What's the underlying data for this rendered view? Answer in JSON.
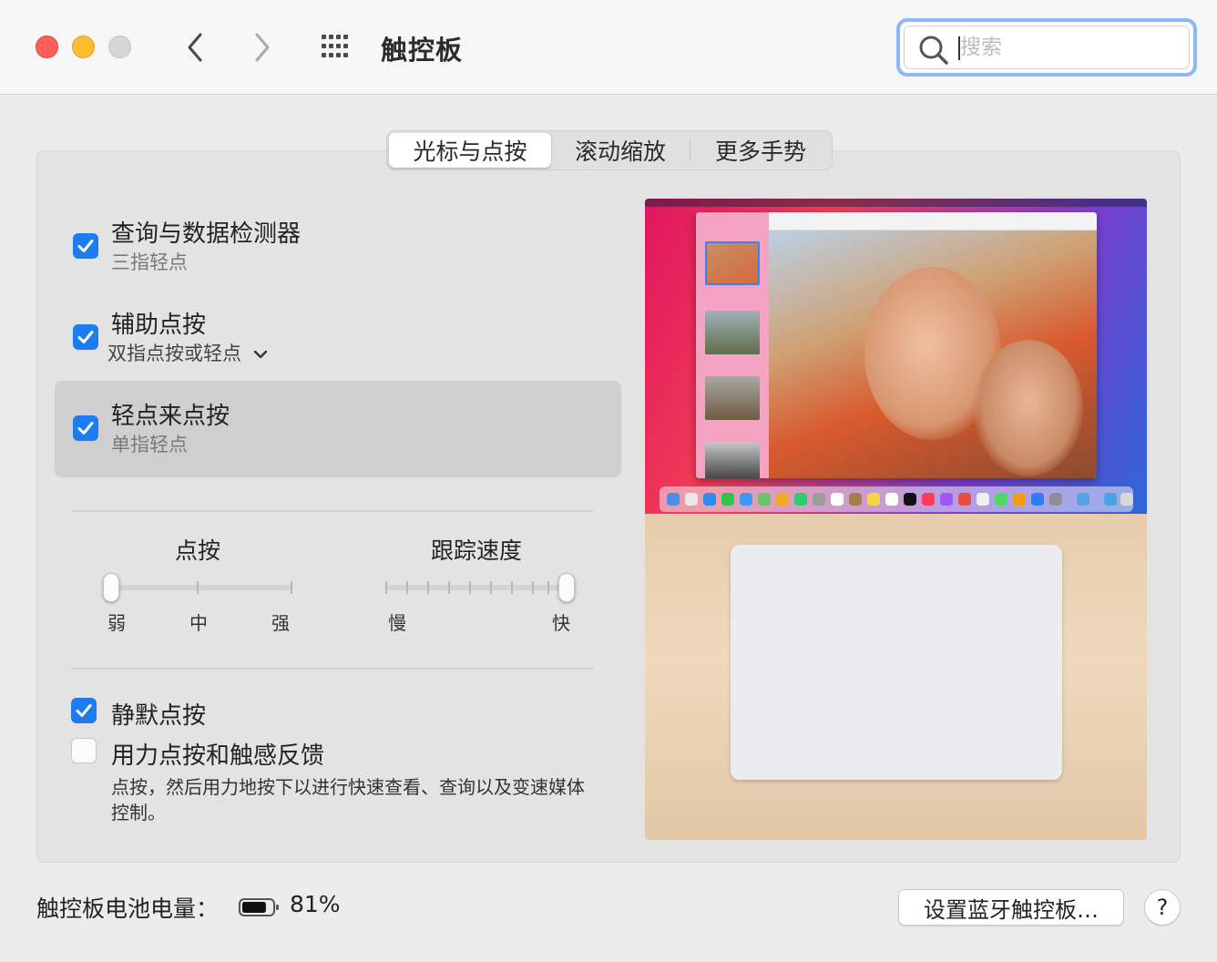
{
  "window": {
    "title": "触控板",
    "search_placeholder": "搜索"
  },
  "tabs": [
    {
      "label": "光标与点按",
      "active": true
    },
    {
      "label": "滚动缩放",
      "active": false
    },
    {
      "label": "更多手势",
      "active": false
    }
  ],
  "options": {
    "lookup": {
      "title": "查询与数据检测器",
      "subtitle": "三指轻点",
      "checked": true
    },
    "secondary_click": {
      "title": "辅助点按",
      "subtitle": "双指点按或轻点",
      "checked": true
    },
    "tap_to_click": {
      "title": "轻点来点按",
      "subtitle": "单指轻点",
      "checked": true
    },
    "silent_click": {
      "title": "静默点按",
      "checked": true
    },
    "force_click": {
      "title": "用力点按和触感反馈",
      "checked": false,
      "description": "点按，然后用力地按下以进行快速查看、查询以及变速媒体控制。"
    }
  },
  "sliders": {
    "click": {
      "title": "点按",
      "labels": [
        "弱",
        "中",
        "强"
      ],
      "value": "弱"
    },
    "tracking": {
      "title": "跟踪速度",
      "labels": [
        "慢",
        "快"
      ],
      "value_fraction": 1.0
    }
  },
  "footer": {
    "battery_label": "触控板电池电量：",
    "battery_value": "81%",
    "battery_fraction": 0.81,
    "setup_button": "设置蓝牙触控板…",
    "help_button": "?"
  },
  "colors": {
    "accent": "#1d7cf2",
    "close": "#fe5f57",
    "minimize": "#febc2e",
    "zoom_disabled": "#d6d6d6"
  },
  "icons": [
    "close-icon",
    "minimize-icon",
    "zoom-icon",
    "chevron-left-icon",
    "chevron-right-icon",
    "grid-icon",
    "search-icon",
    "checkmark-icon",
    "chevron-down-icon",
    "battery-icon"
  ]
}
